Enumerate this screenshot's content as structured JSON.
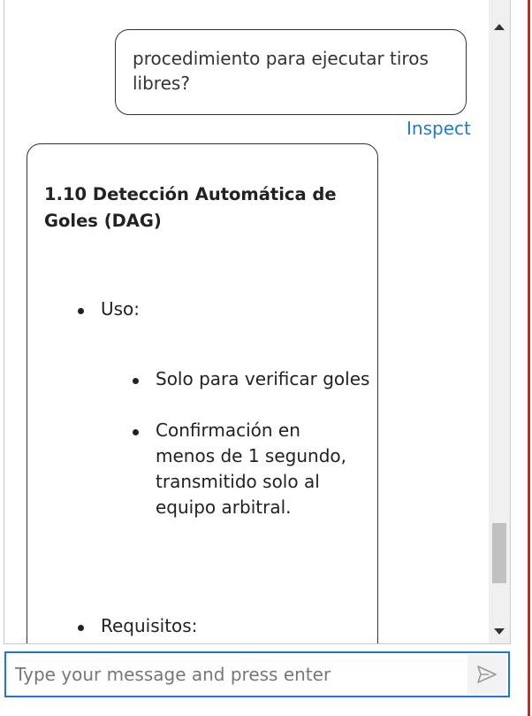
{
  "conversation": {
    "user_message": "procedimiento para ejecutar tiros libres?",
    "inspect_label": "Inspect",
    "bot_response": {
      "title": "1.10 Detección Automática de Goles (DAG)",
      "sections": [
        {
          "label": "Uso:",
          "items": [
            "Solo para verificar goles",
            "Confirmación en menos de 1 segundo, transmitido solo al equipo arbitral."
          ]
        },
        {
          "label": "Requisitos:"
        }
      ]
    }
  },
  "input": {
    "placeholder": "Type your message and press enter",
    "value": ""
  },
  "icons": {
    "send": "send-icon",
    "scroll_up": "scroll-up-arrow-icon",
    "scroll_down": "scroll-down-arrow-icon"
  },
  "colors": {
    "link": "#1f7ad3",
    "input_border": "#1e78d2",
    "bubble_border": "#333333",
    "scroll_thumb": "#c1c1c1",
    "edge_line": "#e0201e"
  }
}
